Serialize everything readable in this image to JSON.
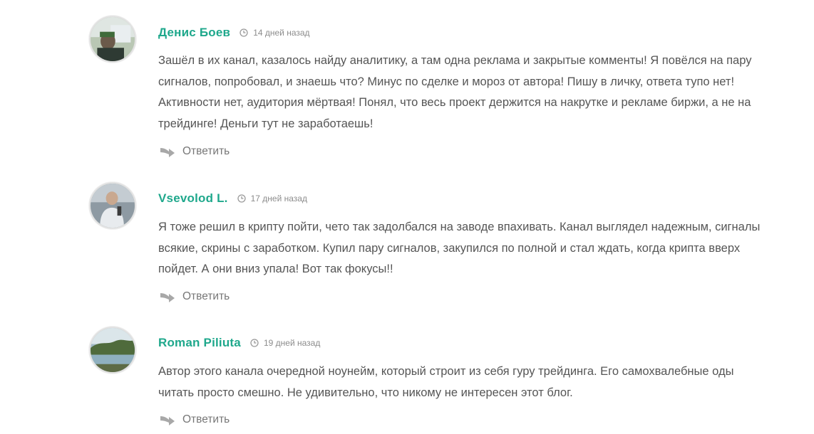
{
  "comments": [
    {
      "author": "Денис Боев",
      "date": "14 дней назад",
      "text": "Зашёл в их канал, казалось найду аналитику, а там одна реклама и закрытые комменты! Я повёлся на пару сигналов, попробовал, и знаешь что? Минус по сделке и мороз от автора! Пишу в личку, ответа тупо нет! Активности нет, аудитория мёртвая! Понял, что весь проект держится на накрутке и рекламе биржи, а не на трейдинге! Деньги тут не заработаешь!",
      "reply_label": "Ответить"
    },
    {
      "author": "Vsevolod L.",
      "date": "17 дней назад",
      "text": "Я тоже решил в крипту пойти, чето так задолбался на заводе впахивать. Канал выглядел надежным, сигналы всякие, скрины с заработком. Купил пару сигналов, закупился по полной и стал ждать, когда крипта вверх пойдет. А они вниз упала! Вот так фокусы!!",
      "reply_label": "Ответить"
    },
    {
      "author": "Roman Piliuta",
      "date": "19 дней назад",
      "text": "Автор этого канала очередной ноунейм, который строит из себя гуру трейдинга. Его самохвалебные оды читать просто смешно. Не удивительно, что никому не интересен этот блог.",
      "reply_label": "Ответить"
    }
  ],
  "colors": {
    "author": "#1fa88c",
    "text": "#555555",
    "meta": "#8c8c8c"
  }
}
